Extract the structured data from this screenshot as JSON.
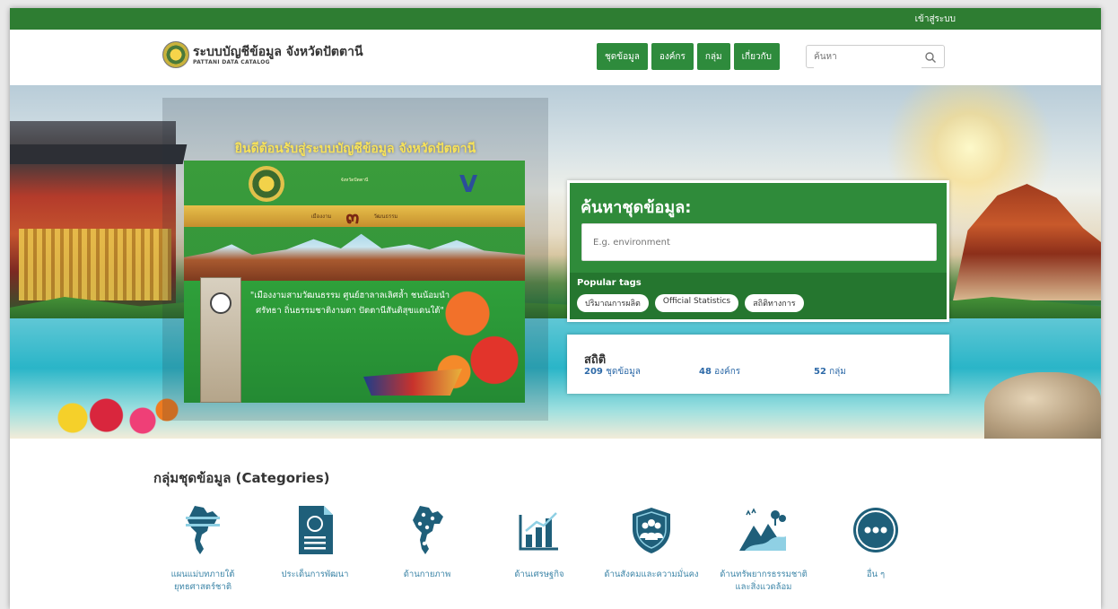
{
  "topbar": {
    "login": "เข้าสู่ระบบ"
  },
  "header": {
    "title": "ระบบบัญชีข้อมูล จังหวัดปัตตานี",
    "subtitle": "PATTANI DATA CATALOG",
    "nav": [
      "ชุดข้อมูล",
      "องค์กร",
      "กลุ่ม",
      "เกี่ยวกับ"
    ],
    "search_placeholder": "ค้นหา"
  },
  "hero": {
    "welcome": "ยินดีต้อนรับสู่ระบบบัญชีข้อมูล จังหวัดปัตตานี",
    "poster_top": "จังหวัดปัตตานี",
    "poster_band_left": "เมืองงาม",
    "poster_band_num": "๓",
    "poster_band_right": "วัฒนธรรม",
    "poster_quote": "\"เมืองงามสามวัฒนธรรม ศูนย์ฮาลาลเลิศล้ำ ชนน้อมนำศรัทธา ถิ่นธรรมชาติงามตา ปัตตานีสันติสุขแดนใต้\""
  },
  "search_panel": {
    "title": "ค้นหาชุดข้อมูล:",
    "placeholder": "E.g. environment",
    "tags_label": "Popular tags",
    "tags": [
      "ปริมาณการผลิต",
      "Official Statistics",
      "สถิติทางการ"
    ]
  },
  "stats": {
    "title": "สถิติ",
    "datasets_count": "209",
    "datasets_label": "ชุดข้อมูล",
    "orgs_count": "48",
    "orgs_label": "องค์กร",
    "groups_count": "52",
    "groups_label": "กลุ่ม"
  },
  "categories": {
    "heading": "กลุ่มชุดข้อมูล (Categories)",
    "items": [
      {
        "label1": "แผนแม่บทภายใต้",
        "label2": "ยุทธศาสตร์ชาติ",
        "icon": "thailand-map-icon"
      },
      {
        "label1": "ประเด็นการพัฒนา",
        "label2": "",
        "icon": "document-icon"
      },
      {
        "label1": "ด้านกายภาพ",
        "label2": "",
        "icon": "thailand-pins-icon"
      },
      {
        "label1": "ด้านเศรษฐกิจ",
        "label2": "",
        "icon": "bar-chart-icon"
      },
      {
        "label1": "ด้านสังคมและความมั่นคง",
        "label2": "",
        "icon": "people-shield-icon"
      },
      {
        "label1": "ด้านทรัพยากรธรรมชาติ",
        "label2": "และสิ่งแวดล้อม",
        "icon": "nature-icon"
      },
      {
        "label1": "อื่น ๆ",
        "label2": "",
        "icon": "more-icon"
      }
    ]
  },
  "colors": {
    "brand_green": "#2e8b3c",
    "dark_green": "#2e7d32",
    "link_blue": "#2e6aa8",
    "icon_teal": "#1f5f7a"
  }
}
